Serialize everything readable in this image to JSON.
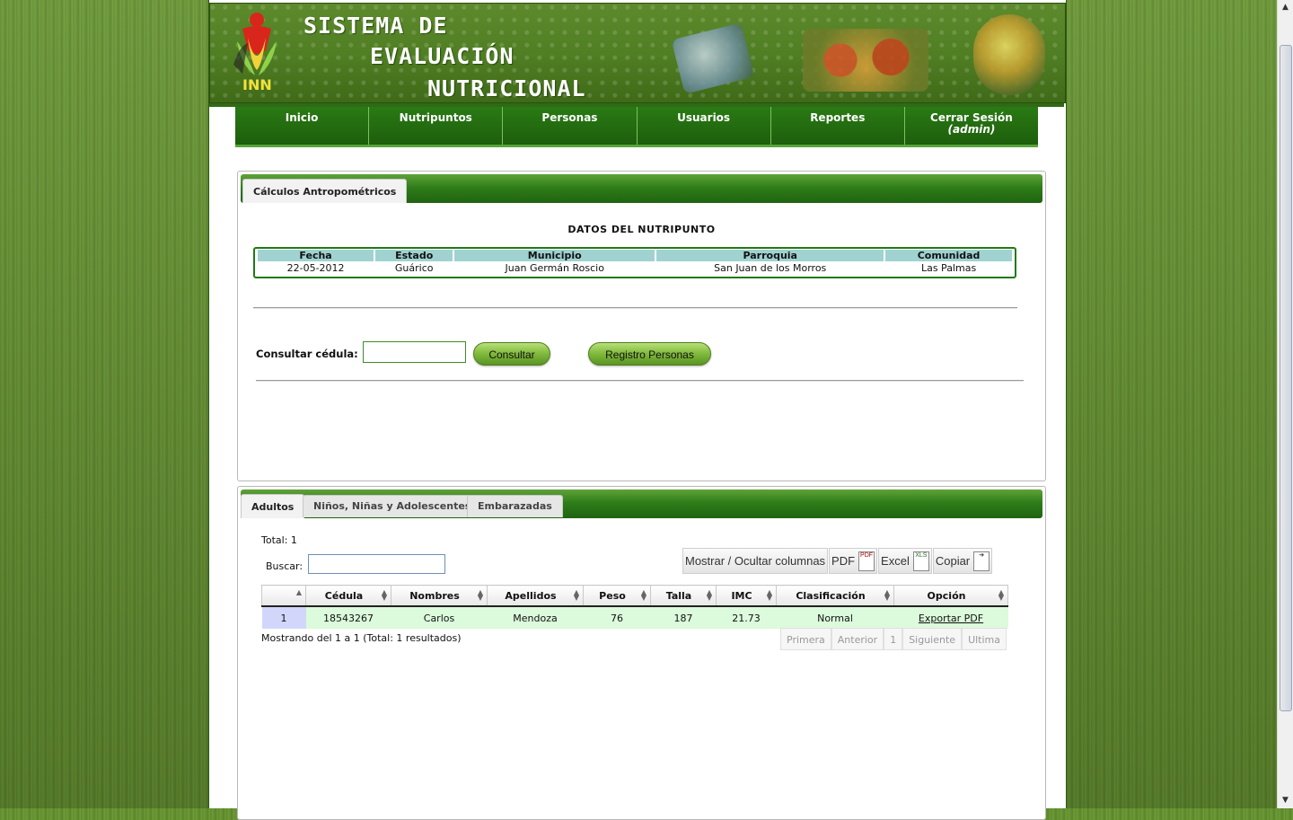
{
  "banner": {
    "line1": "SISTEMA DE",
    "line2": "EVALUACIÓN",
    "line3": "NUTRICIONAL",
    "logo_text": "INN"
  },
  "nav": [
    {
      "label": "Inicio"
    },
    {
      "label": "Nutripuntos"
    },
    {
      "label": "Personas"
    },
    {
      "label": "Usuarios"
    },
    {
      "label": "Reportes"
    },
    {
      "label": "Cerrar Sesión",
      "sub": "(admin)"
    }
  ],
  "calc": {
    "tab": "Cálculos Antropométricos",
    "section_title": "DATOS DEL NUTRIPUNTO",
    "headers": [
      "Fecha",
      "Estado",
      "Municipio",
      "Parroquia",
      "Comunidad"
    ],
    "values": [
      "22-05-2012",
      "Guárico",
      "Juan Germán Roscio",
      "San Juan de los Morros",
      "Las Palmas"
    ],
    "consult_label": "Consultar cédula:",
    "cedula_value": "",
    "consult_button": "Consultar",
    "register_button": "Registro Personas"
  },
  "results": {
    "tabs": [
      "Adultos",
      "Niños, Niñas y Adolescentes",
      "Embarazadas"
    ],
    "total": "Total: 1",
    "search_label": "Buscar:",
    "search_value": "",
    "tools": [
      "Mostrar / Ocultar columnas",
      "PDF",
      "Excel",
      "Copiar"
    ],
    "columns": [
      "",
      "Cédula",
      "Nombres",
      "Apellidos",
      "Peso",
      "Talla",
      "IMC",
      "Clasificación",
      "Opción"
    ],
    "rows": [
      [
        "1",
        "18543267",
        "Carlos",
        "Mendoza",
        "76",
        "187",
        "21.73",
        "Normal",
        "Exportar PDF"
      ]
    ],
    "showing": "Mostrando del 1 a 1 (Total: 1 resultados)",
    "pager": [
      "Primera",
      "Anterior",
      "1",
      "Siguiente",
      "Ultima"
    ]
  },
  "colors": {
    "accent": "#2a7a14",
    "nav_bg": "#1d5e0c",
    "row_bg": "#dcfadc"
  }
}
